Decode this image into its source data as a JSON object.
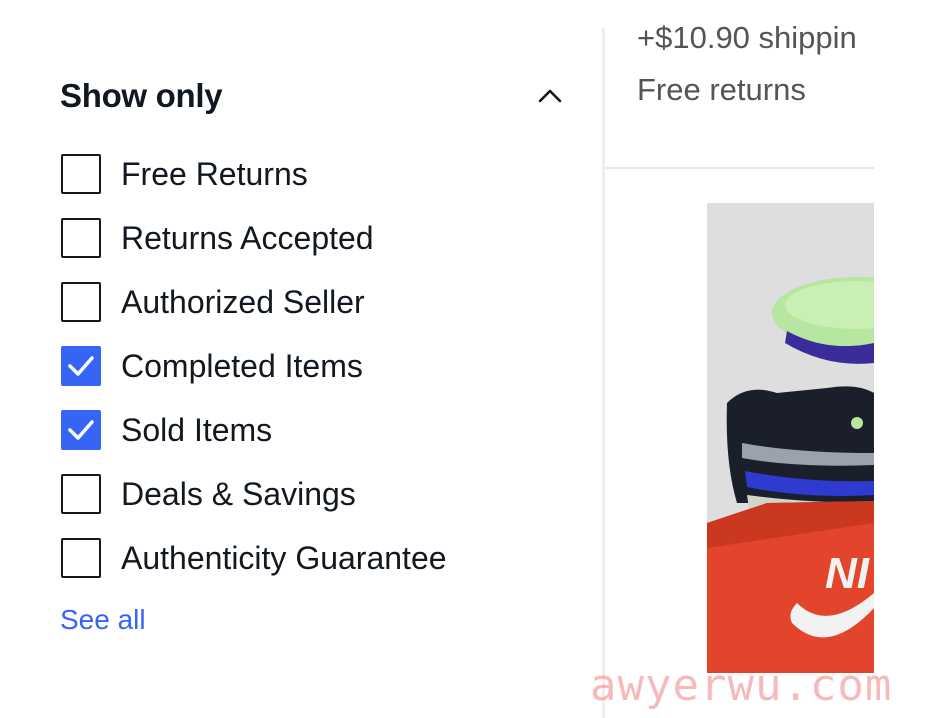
{
  "filter": {
    "title": "Show only",
    "options": [
      {
        "label": "Free Returns",
        "checked": false
      },
      {
        "label": "Returns Accepted",
        "checked": false
      },
      {
        "label": "Authorized Seller",
        "checked": false
      },
      {
        "label": "Completed Items",
        "checked": true
      },
      {
        "label": "Sold Items",
        "checked": true
      },
      {
        "label": "Deals & Savings",
        "checked": false
      },
      {
        "label": "Authenticity Guarantee",
        "checked": false
      }
    ],
    "see_all": "See all"
  },
  "listing": {
    "shipping": "+$10.90 shippin",
    "returns": "Free returns",
    "image_icon": "sneaker-on-shoebox-photo"
  },
  "colors": {
    "accent": "#3665f3",
    "text": "#111820",
    "muted": "#555555"
  },
  "watermark": "awyerwu.com"
}
